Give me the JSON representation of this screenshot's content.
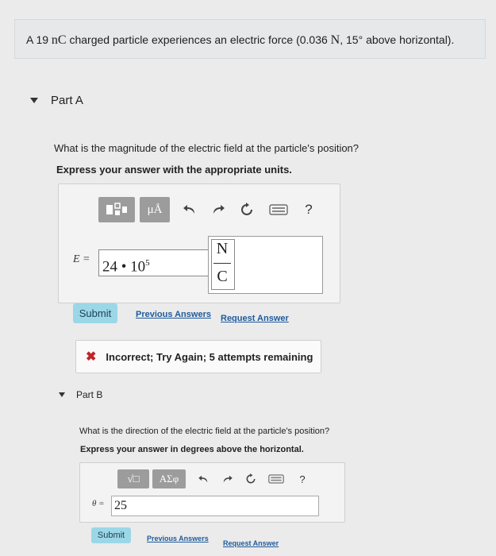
{
  "problem": {
    "prefix": "A 19 ",
    "charge_unit": "nC",
    "middle": " charged particle experiences an electric force (0.036 ",
    "force_unit": "N",
    "suffix": ", 15° above horizontal)."
  },
  "partA": {
    "title": "Part A",
    "question": "What is the magnitude of the electric field at the particle's position?",
    "instruction": "Express your answer with the appropriate units.",
    "toolbar": {
      "mu_label": "μÅ",
      "help": "?"
    },
    "var_label": "E =",
    "answer": "24 • 10",
    "answer_exp": "5",
    "unit_num": "N",
    "unit_den": "C",
    "submit": "Submit",
    "prev_answers": "Previous Answers",
    "request_answer": "Request Answer",
    "feedback": "Incorrect; Try Again; 5 attempts remaining"
  },
  "partB": {
    "title": "Part B",
    "question": "What is the direction of the electric field at the particle's position?",
    "instruction": "Express your answer in degrees above the horizontal.",
    "toolbar": {
      "root_label": "√□",
      "greek_label": "ΑΣφ",
      "help": "?"
    },
    "var_label": "θ =",
    "answer": "25",
    "submit": "Submit",
    "prev_answers": "Previous Answers",
    "request_answer": "Request Answer"
  }
}
